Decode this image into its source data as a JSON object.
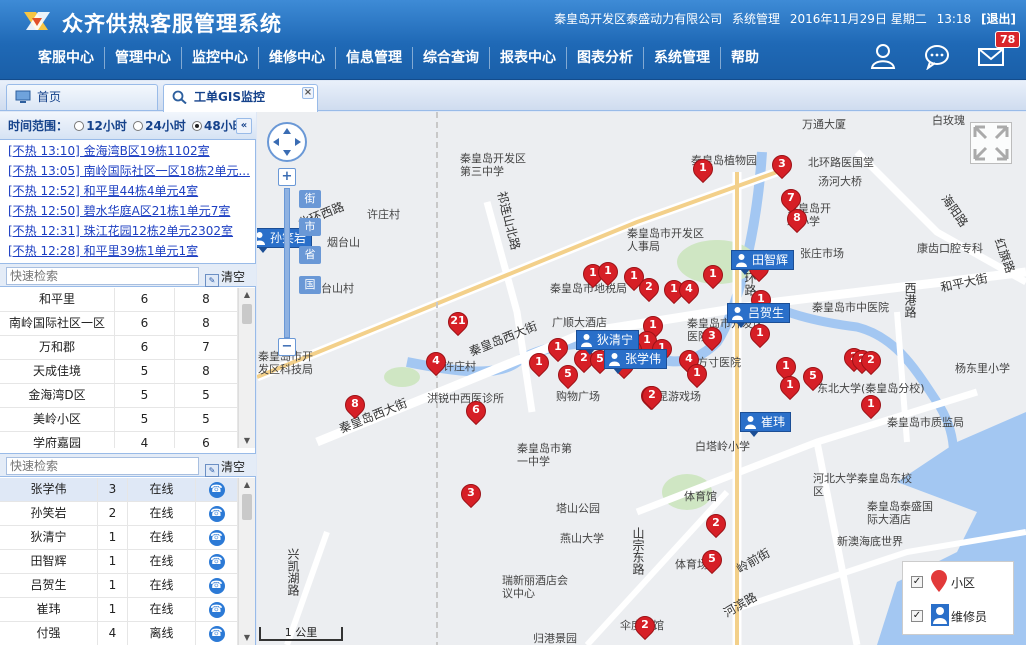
{
  "header": {
    "title": "众齐供热客服管理系统",
    "company": "秦皇岛开发区泰盛动力有限公司",
    "role": "系统管理",
    "date": "2016年11月29日 星期二",
    "time": "13:18",
    "logout": "[退出]",
    "mail_count": "78",
    "nav": [
      "客服中心",
      "管理中心",
      "监控中心",
      "维修中心",
      "信息管理",
      "综合查询",
      "报表中心",
      "图表分析",
      "系统管理",
      "帮助"
    ]
  },
  "tabs": [
    {
      "label": "首页"
    },
    {
      "label": "工单GIS监控"
    }
  ],
  "sidebar": {
    "range_label": "时间范围：",
    "range_options": [
      "12小时",
      "24小时",
      "48小时"
    ],
    "range_selected": "48小时",
    "alerts": [
      "[不热 13:10] 金海湾B区19栋1102室",
      "[不热 13:05] 南岭国际社区一区18栋2单元...",
      "[不热 12:52] 和平里44栋4单元4室",
      "[不热 12:50] 碧水华庭A区21栋1单元7室",
      "[不热 12:31] 珠江花园12栋2单元2302室",
      "[不热 12:28] 和平里39栋1单元1室"
    ],
    "community_search": {
      "placeholder": "快速检索",
      "clear": "清空"
    },
    "communities": [
      [
        "和平里",
        "6",
        "8"
      ],
      [
        "南岭国际社区一区",
        "6",
        "8"
      ],
      [
        "万和郡",
        "6",
        "7"
      ],
      [
        "天成佳境",
        "5",
        "8"
      ],
      [
        "金海湾D区",
        "5",
        "5"
      ],
      [
        "美岭小区",
        "5",
        "5"
      ],
      [
        "学府嘉园",
        "4",
        "6"
      ]
    ],
    "staff_search": {
      "placeholder": "快速检索",
      "clear": "清空"
    },
    "staff": [
      [
        "张学伟",
        "3",
        "在线"
      ],
      [
        "孙笑岩",
        "2",
        "在线"
      ],
      [
        "狄清宁",
        "1",
        "在线"
      ],
      [
        "田智辉",
        "1",
        "在线"
      ],
      [
        "吕贺生",
        "1",
        "在线"
      ],
      [
        "崔玮",
        "1",
        "在线"
      ],
      [
        "付强",
        "4",
        "离线"
      ]
    ]
  },
  "map": {
    "zoom_tags": [
      "街",
      "市",
      "省",
      "国"
    ],
    "scale": "1 公里",
    "labels": {
      "l1": "万通大厦",
      "l2": "白玫瑰",
      "l3": "秦皇岛植物园",
      "l4": "北环路医国堂",
      "l5": "汤河大桥",
      "l6": "秦皇岛开发区第三中学",
      "l7": "许庄村",
      "l8": "北环西路",
      "l9": "烟台山",
      "l10": "烟台山村",
      "l11": "祁连山北路",
      "l12": "秦皇岛市开发区人事局",
      "l13": "秦皇岛开发小学",
      "l14": "张庄市场",
      "l15": "康齿口腔专科",
      "l16": "海阳路",
      "l17": "红旗路",
      "l18": "西港路",
      "l19": "和平大街",
      "l20": "秦皇岛市地税局",
      "l21": "广顺大酒店",
      "l22": "秦皇岛市开发区医院",
      "l23": "秦皇岛市中医院",
      "l24": "环路",
      "l25": "秦皇岛西大街",
      "l26": "秦皇岛市开发区科技局",
      "l27": "许庄村",
      "l28": "购物广场",
      "l29": "洪锐中西医诊所",
      "l30": "东北大学(秦皇岛分校)",
      "l31": "秦皇岛市质监局",
      "l32": "杨东里小学",
      "l33": "秦皇岛西大街",
      "l34": "秦皇岛市第一中学",
      "l35": "白塔岭小学",
      "l36": "体育馆",
      "l37": "河北大学秦皇岛东校区",
      "l38": "秦皇岛泰盛国际大酒店",
      "l39": "新澳海底世界",
      "l40": "塔山公园",
      "l41": "燕山大学",
      "l42": "体育场",
      "l43": "山宗东路",
      "l44": "岭前街",
      "l45": "瑞新丽酒店会议中心",
      "l46": "兴凯湖路",
      "l47": "河滨路",
      "l48": "归港景园",
      "l49": "伞度展馆",
      "l50": "昆游戏场",
      "l51": "方寸医院"
    },
    "pins": [
      "1",
      "3",
      "7",
      "8",
      "1",
      "1",
      "1",
      "2",
      "1",
      "4",
      "1",
      "4",
      "1",
      "1",
      "3",
      "1",
      "1",
      "1",
      "1",
      "1",
      "5",
      "21",
      "4",
      "1",
      "2",
      "5",
      "2",
      "2",
      "4",
      "1",
      "1",
      "1",
      "5",
      "2",
      "2",
      "2",
      "1",
      "8",
      "6",
      "2",
      "3",
      "2",
      "5",
      "2"
    ],
    "staff_markers": [
      "田智辉",
      "吕贺生",
      "狄清宁",
      "张学伟",
      "崔玮",
      "孙笑岩"
    ],
    "legend": {
      "community": "小区",
      "staff": "维修员"
    }
  }
}
